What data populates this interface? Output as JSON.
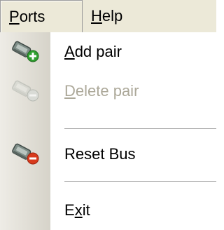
{
  "menubar": {
    "ports": {
      "prefix": "",
      "mnemonic": "P",
      "suffix": "orts"
    },
    "help": {
      "prefix": "",
      "mnemonic": "H",
      "suffix": "elp"
    }
  },
  "menu": {
    "add_pair": {
      "prefix": "",
      "mnemonic": "A",
      "suffix": "dd pair",
      "icon": "add-pair-icon"
    },
    "delete_pair": {
      "prefix": "",
      "mnemonic": "D",
      "suffix": "elete pair",
      "icon": "delete-pair-icon",
      "disabled": true
    },
    "reset_bus": {
      "label": "Reset Bus",
      "icon": "reset-bus-icon"
    },
    "exit": {
      "prefix": "E",
      "mnemonic": "x",
      "suffix": "it"
    }
  },
  "colors": {
    "menubar_bg": "#ece9d8",
    "gutter_start": "#eeece6",
    "gutter_end": "#d6d3c9",
    "disabled_text": "#aca899",
    "add_badge": "#2e9e2e",
    "remove_badge": "#d83a1c"
  }
}
